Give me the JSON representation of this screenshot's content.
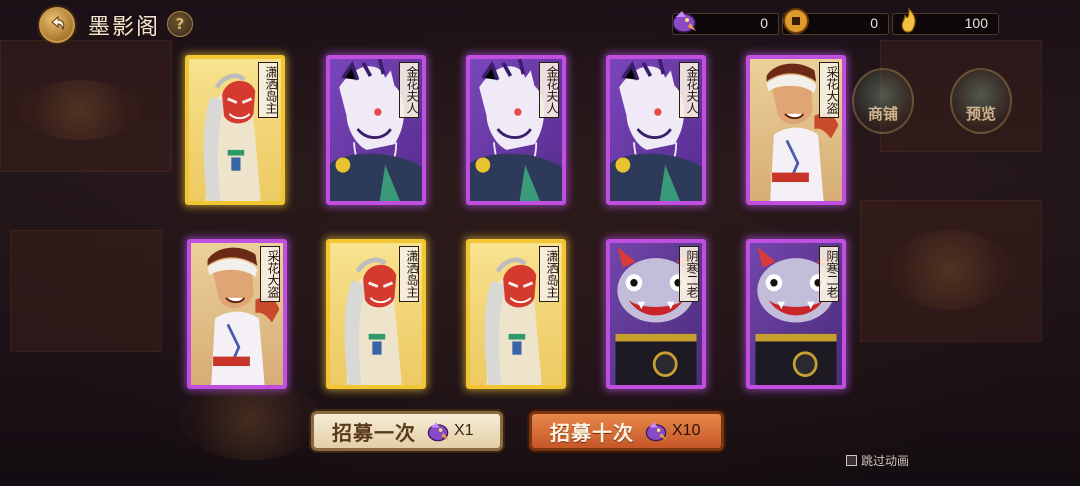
{
  "header": {
    "title": "墨影阁",
    "help_label": "?"
  },
  "currencies": [
    {
      "icon": "purple-bird-token-icon",
      "value": "0"
    },
    {
      "icon": "copper-coin-icon",
      "value": "0"
    },
    {
      "icon": "gold-flame-icon",
      "value": "100"
    }
  ],
  "side_buttons": {
    "shop_label": "商铺",
    "preview_label": "预览"
  },
  "cards": [
    {
      "name": "潇洒岛主",
      "rarity": "gold",
      "portrait": "masked-swordsman"
    },
    {
      "name": "金花夫人",
      "rarity": "purple",
      "portrait": "dragon-mask-lady"
    },
    {
      "name": "金花夫人",
      "rarity": "purple",
      "portrait": "dragon-mask-lady"
    },
    {
      "name": "金花夫人",
      "rarity": "purple",
      "portrait": "dragon-mask-lady"
    },
    {
      "name": "采花大盗",
      "rarity": "purple",
      "portrait": "headband-bandit"
    },
    {
      "name": "采花大盗",
      "rarity": "purple",
      "portrait": "headband-bandit"
    },
    {
      "name": "潇洒岛主",
      "rarity": "gold",
      "portrait": "masked-swordsman"
    },
    {
      "name": "潇洒岛主",
      "rarity": "gold",
      "portrait": "masked-swordsman"
    },
    {
      "name": "阴寒二老",
      "rarity": "purple",
      "portrait": "horned-elder"
    },
    {
      "name": "阴寒二老",
      "rarity": "purple",
      "portrait": "horned-elder"
    }
  ],
  "recruit": {
    "once_label": "招募一次",
    "once_cost": "X1",
    "ten_label": "招募十次",
    "ten_cost": "X10"
  },
  "skip_animation_label": "跳过动画",
  "colors": {
    "gold_border": "#f2c632",
    "purple_border": "#c04fe0",
    "once_button": "#efe1c2",
    "ten_button": "#d96d38"
  }
}
